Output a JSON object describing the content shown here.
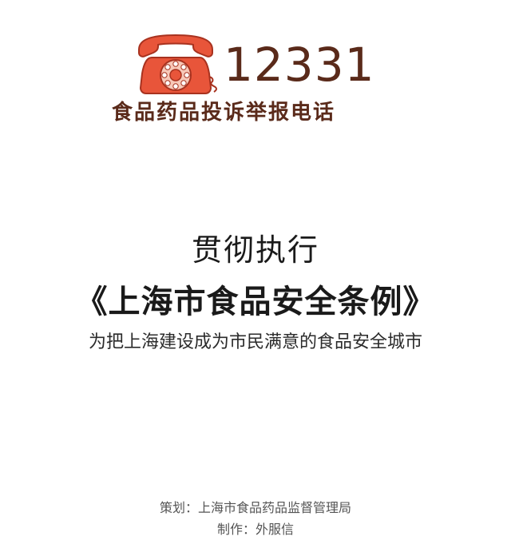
{
  "logo": {
    "number": "12331",
    "caption": "食品药品投诉举报电话",
    "phone_icon": "rotary-phone-icon"
  },
  "headline": {
    "line1": "贯彻执行",
    "line2": "《上海市食品安全条例》",
    "line3": "为把上海建设成为市民满意的食品安全城市"
  },
  "credits": {
    "planning": "策划：上海市食品药品监督管理局",
    "production": "制作：外服信"
  },
  "colors": {
    "phone_red": "#e8553a",
    "phone_dark": "#a8321f",
    "logo_text": "#5a2a1a",
    "headline_text": "#1a1a1a",
    "credit_text": "#555555",
    "background": "#ffffff"
  }
}
